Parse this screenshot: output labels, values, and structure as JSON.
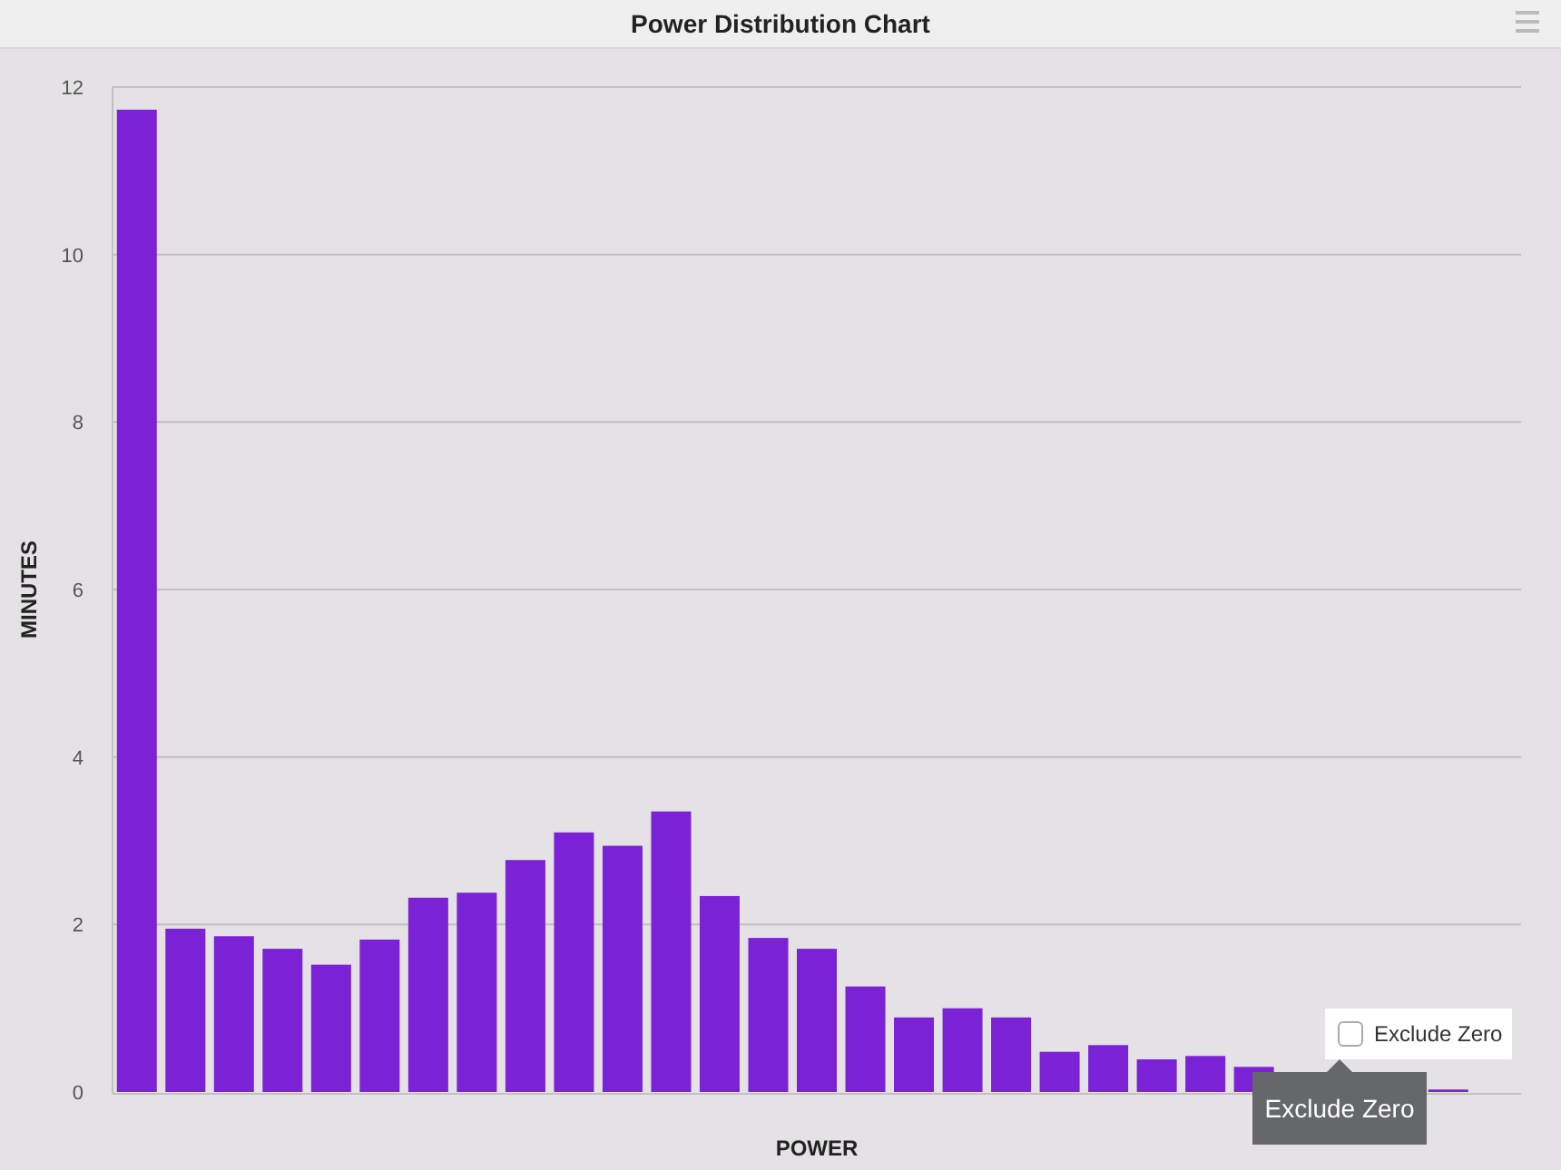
{
  "title": "Power Distribution Chart",
  "chart_data": {
    "type": "bar",
    "xlabel": "POWER",
    "ylabel": "MINUTES",
    "ylim": [
      0,
      12
    ],
    "yticks": [
      0,
      2,
      4,
      6,
      8,
      10,
      12
    ],
    "grid": true,
    "series": [
      {
        "color": "#7b22d6",
        "values": [
          11.73,
          1.95,
          1.86,
          1.71,
          1.52,
          1.82,
          2.32,
          2.38,
          2.77,
          3.1,
          2.94,
          3.35,
          2.34,
          1.84,
          1.71,
          1.26,
          0.89,
          1.0,
          0.89,
          0.48,
          0.56,
          0.39,
          0.43,
          0.3,
          null,
          null,
          null,
          0.03,
          0
        ]
      }
    ]
  },
  "exclude_zero": {
    "label": "Exclude Zero",
    "checked": false
  },
  "tooltip": {
    "text": "Exclude Zero"
  }
}
